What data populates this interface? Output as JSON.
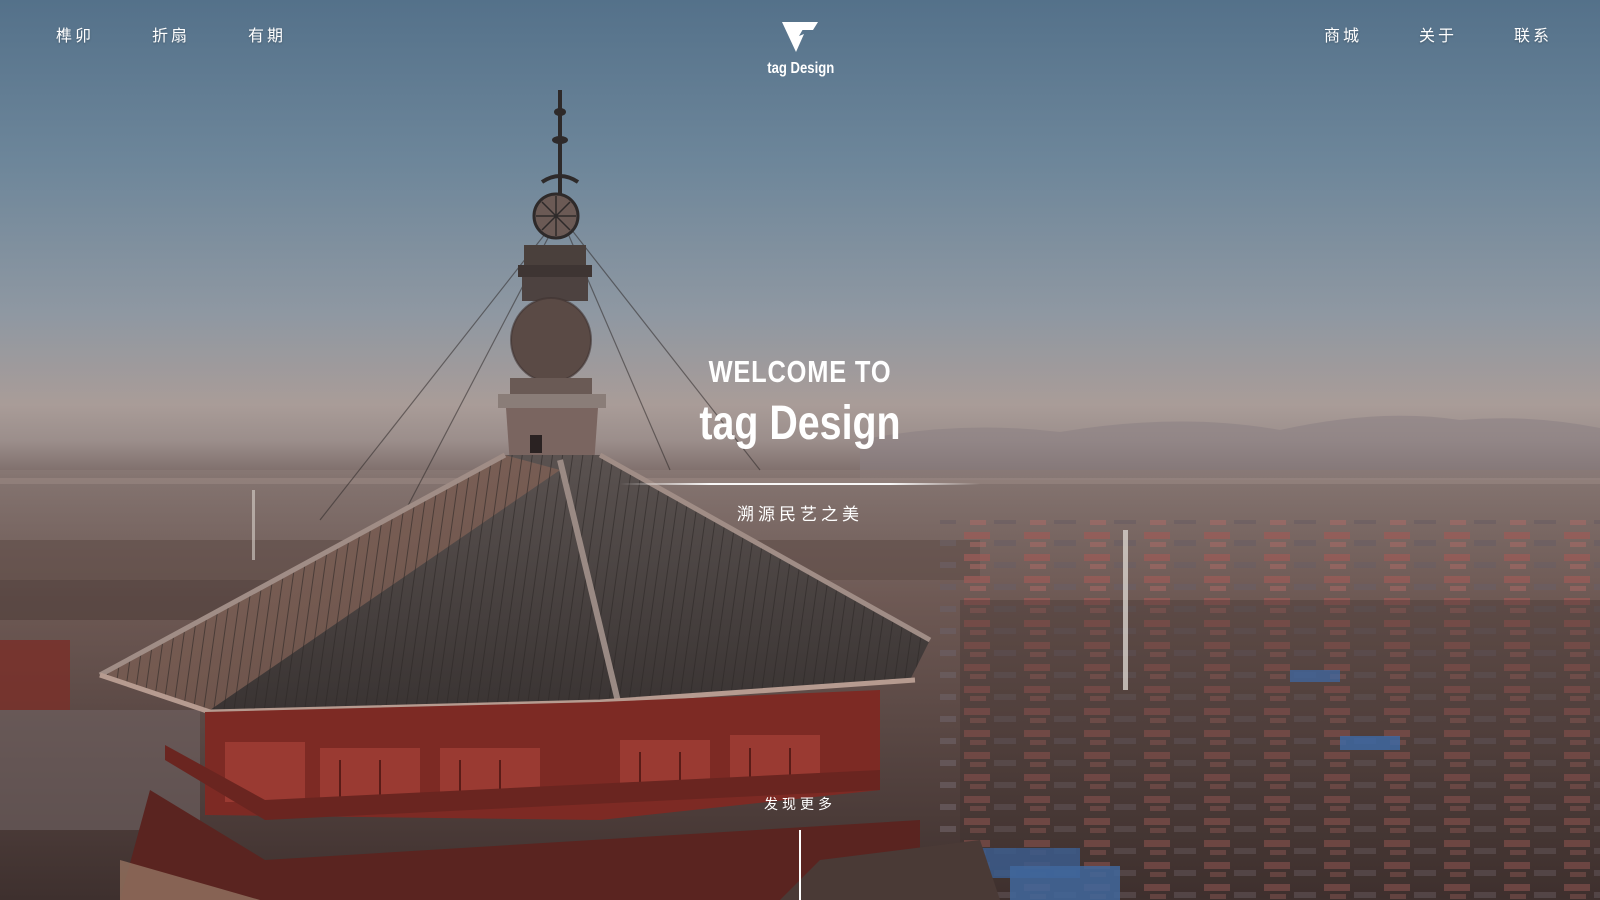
{
  "nav": {
    "left_items": [
      {
        "label": "榫卯"
      },
      {
        "label": "折扇"
      },
      {
        "label": "有期"
      }
    ],
    "right_items": [
      {
        "label": "商城"
      },
      {
        "label": "关于"
      },
      {
        "label": "联系"
      }
    ],
    "logo": {
      "text": "tag Design",
      "icon": "tag-logo-icon"
    }
  },
  "hero": {
    "welcome_line1": "WELCOME TO",
    "welcome_line2": "tag Design",
    "tagline": "溯源民艺之美",
    "discover": "发现更多",
    "background": "aerial-pagoda-landscape-photo"
  },
  "colors": {
    "text": "#ffffff",
    "sky_top": "#54718a",
    "horizon": "#a99c98",
    "roof": "#4a4442",
    "wall_red": "#8a2a24"
  }
}
